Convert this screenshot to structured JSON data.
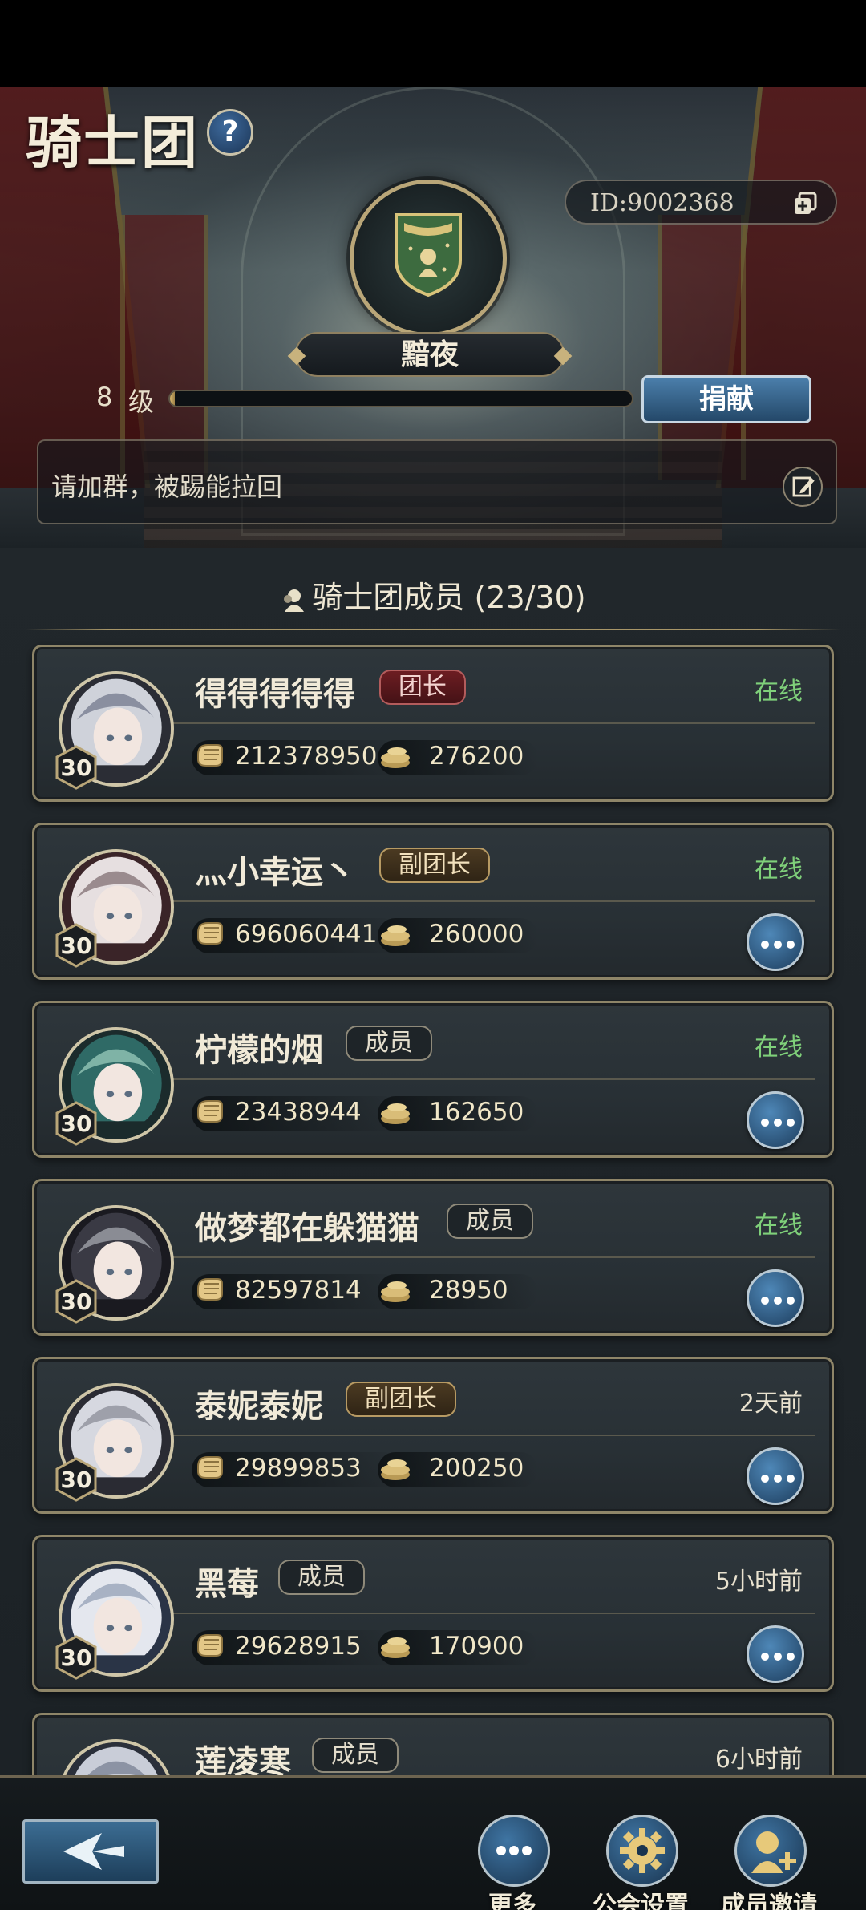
{
  "header": {
    "title": "骑士团",
    "help_label": "?",
    "guild_id": "ID:9002368",
    "guild_name": "黯夜",
    "level_number": "8",
    "level_label": "级",
    "level_progress": 0.01,
    "donate_label": "捐献",
    "notice": "请加群，被踢能拉回"
  },
  "members_section": {
    "title": "骑士团成员 (23/30)"
  },
  "members": [
    {
      "name": "得得得得得",
      "role": "团长",
      "role_type": "leader",
      "level": "30",
      "power": "212378950",
      "coins": "276200",
      "status": "在线",
      "online": true,
      "has_more": false
    },
    {
      "name": "灬小幸运丶",
      "role": "副团长",
      "role_type": "vice",
      "level": "30",
      "power": "696060441",
      "coins": "260000",
      "status": "在线",
      "online": true,
      "has_more": true
    },
    {
      "name": "柠檬的烟",
      "role": "成员",
      "role_type": "member",
      "level": "30",
      "power": "23438944",
      "coins": "162650",
      "status": "在线",
      "online": true,
      "has_more": true
    },
    {
      "name": "做梦都在躲猫猫",
      "role": "成员",
      "role_type": "member",
      "level": "30",
      "power": "82597814",
      "coins": "28950",
      "status": "在线",
      "online": true,
      "has_more": true
    },
    {
      "name": "泰妮泰妮",
      "role": "副团长",
      "role_type": "vice",
      "level": "30",
      "power": "29899853",
      "coins": "200250",
      "status": "2天前",
      "online": false,
      "has_more": true
    },
    {
      "name": "黑莓",
      "role": "成员",
      "role_type": "member",
      "level": "30",
      "power": "29628915",
      "coins": "170900",
      "status": "5小时前",
      "online": false,
      "has_more": true
    },
    {
      "name": "莲凌寒",
      "role": "成员",
      "role_type": "member",
      "level": "30",
      "power": "",
      "coins": "",
      "status": "6小时前",
      "online": false,
      "has_more": true
    }
  ],
  "bottom_nav": {
    "more_label": "更多",
    "settings_label": "公会设置",
    "invite_label": "成员邀请"
  },
  "colors": {
    "online": "#7fd07a",
    "leader_badge": "#6d1d22",
    "vice_badge": "#4b3a22",
    "button_blue": "#3f75a3"
  }
}
